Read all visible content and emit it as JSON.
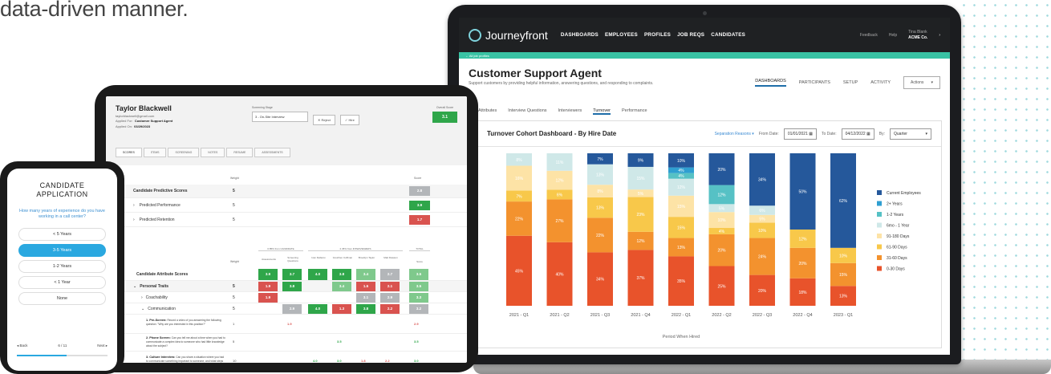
{
  "intro_text": "data-driven manner.",
  "laptop": {
    "app_name": "Journeyfront",
    "nav": [
      "DASHBOARDS",
      "EMPLOYEES",
      "PROFILES",
      "JOB REQS",
      "CANDIDATES"
    ],
    "feedback": "Feedback",
    "help": "Help",
    "user_name": "Tina Blank",
    "company": "ACME Co.",
    "back_link": "← All job profiles",
    "title": "Customer Support Agent",
    "subtitle": "Support customers by providing helpful information, answering questions, and responding to complaints.",
    "tabs": [
      "DASHBOARDS",
      "PARTICIPANTS",
      "SETUP",
      "ACTIVITY"
    ],
    "actions": "Actions",
    "subtabs": [
      "Attributes",
      "Interview Questions",
      "Interviewers",
      "Turnover",
      "Performance"
    ],
    "active_subtab": "Turnover",
    "card_title": "Turnover Cohort Dashboard - By Hire Date",
    "separation": "Separation Reasons",
    "from_label": "From Date:",
    "from_date": "01/01/2021",
    "to_label": "To Date:",
    "to_date": "04/12/2022",
    "by_label": "By:",
    "by_value": "Quarter"
  },
  "chart_data": {
    "type": "bar",
    "stacked": true,
    "xlabel": "Period When Hired",
    "categories": [
      "2021 - Q1",
      "2021 - Q2",
      "2021 - Q3",
      "2021 - Q4",
      "2022 - Q1",
      "2022 - Q2",
      "2022 - Q3",
      "2022 - Q4",
      "2023 - Q1"
    ],
    "series": [
      {
        "name": "0-30 Days",
        "color": "#e8532b",
        "values": [
          45,
          40,
          34,
          37,
          35,
          25,
          20,
          18,
          13
        ]
      },
      {
        "name": "31-60 Days",
        "color": "#f3922e",
        "values": [
          22,
          27,
          22,
          12,
          13,
          20,
          24,
          20,
          15
        ]
      },
      {
        "name": "61-90 Days",
        "color": "#f8c84a",
        "values": [
          7,
          6,
          13,
          23,
          15,
          4,
          10,
          12,
          10
        ]
      },
      {
        "name": "91-180 Days",
        "color": "#fde3a6",
        "values": [
          16,
          12,
          8,
          5,
          15,
          10,
          5,
          0,
          0
        ]
      },
      {
        "name": "6mo - 1 Year",
        "color": "#cfe8e8",
        "values": [
          8,
          11,
          13,
          15,
          12,
          5,
          6,
          0,
          0
        ]
      },
      {
        "name": "1-2 Years",
        "color": "#56c1c5",
        "values": [
          0,
          0,
          0,
          0,
          4,
          12,
          0,
          0,
          0
        ]
      },
      {
        "name": "2+ Years",
        "color": "#2f9fd1",
        "values": [
          0,
          0,
          0,
          0,
          4,
          0,
          0,
          0,
          0
        ]
      },
      {
        "name": "Current Employees",
        "color": "#25589b",
        "values": [
          0,
          0,
          7,
          9,
          10,
          20,
          34,
          50,
          62
        ]
      }
    ],
    "legend_order": [
      "Current Employees",
      "2+ Years",
      "1-2 Years",
      "6mo - 1 Year",
      "91-180 Days",
      "61-90 Days",
      "31-60 Days",
      "0-30 Days"
    ],
    "legend_position": "right",
    "ylim": [
      0,
      100
    ]
  },
  "tablet": {
    "name": "Taylor Blackwell",
    "email": "taylorblackwell@gmail.com",
    "applied_for_label": "Applied For:",
    "applied_for": "Customer Support Agent",
    "applied_on_label": "Applied On:",
    "applied_on": "03/29/2023",
    "stage_label": "Screening Stage",
    "stage_value": "3 - On-Site Interview",
    "reject": "Reject",
    "hire": "Hire",
    "overall_label": "Overall Score",
    "overall_score": "3.1",
    "tabs": [
      "SCORES",
      "ITEMS",
      "SCREENING",
      "NOTES",
      "RESUME",
      "ASSESSMENTS"
    ],
    "weight_header": "Weight",
    "score_header": "Score",
    "predictive_title": "Candidate Predictive Scores",
    "predictive_weight": "5",
    "predictive_score": "2.8",
    "pred_perf": "Predicted Performance",
    "pred_perf_weight": "5",
    "pred_perf_score": "3.9",
    "pred_ret": "Predicted Retention",
    "pred_ret_weight": "5",
    "pred_ret_score": "1.7",
    "group1": "0.85% from CANDIDATE",
    "group2": "2.45% from INTERVIEWERS",
    "total": "TOTAL",
    "col_assess": "Assessments",
    "col_screen": "Screening Questions",
    "col_ivan": "Ivan Dellarov",
    "col_gretchen": "Gretchen Coffman",
    "col_brooklyn": "Brooklyn Taylor",
    "col_matt": "Matt Dawson",
    "attr_title": "Candidate Attribute Scores",
    "attr_scores": [
      "3.9",
      "3.7",
      "4.0",
      "3.8",
      "3.4",
      "2.7",
      "3.5"
    ],
    "pt_label": "Personal Traits",
    "pt_weight": "5",
    "pt_scores": [
      "1.9",
      "3.8",
      "",
      "3.4",
      "1.5",
      "2.1",
      "3.5"
    ],
    "coach_label": "Coachability",
    "coach_weight": "5",
    "coach_scores": [
      "1.9",
      "",
      "",
      "",
      "3.1",
      "2.9",
      "3.3"
    ],
    "comm_label": "Communication",
    "comm_weight": "5",
    "comm_scores": [
      "",
      "2.9",
      "4.0",
      "1.3",
      "3.8",
      "2.2",
      "3.2"
    ],
    "q1_title": "1. Pre-Screen:",
    "q1_text": "Record a video of you answering the following question: \"Why are you interested in this position?\"",
    "q1_weight": "1",
    "q1_scores": [
      "",
      "1.9",
      "",
      "",
      "",
      "",
      "2.9"
    ],
    "q2_title": "2. Phone Screen:",
    "q2_text": "Can you tell me about a time when you had to communicate a complex idea to someone who had little knowledge about the subject?",
    "q2_weight": "5",
    "q2_scores": [
      "",
      "",
      "",
      "3.5",
      "",
      "",
      "3.5"
    ],
    "q3_title": "3. Culture Interview:",
    "q3_text": "Can you share a situation where you had to communicate something important to someone, and what steps did you take to ensure that your message was effectively received and understood by the other person?",
    "q3_weight": "10",
    "q3_scores": [
      "",
      "",
      "4.0",
      "3.0",
      "1.8",
      "2.2",
      "3.0"
    ]
  },
  "phone": {
    "title1": "CANDIDATE",
    "title2": "APPLICATION",
    "question": "How many years of experience do you have working in a call center?",
    "options": [
      "< 5 Years",
      "3-5 Years",
      "1-2 Years",
      "< 1 Year",
      "None"
    ],
    "selected_index": 1,
    "back": "◂  Back",
    "progress_text": "6 / 11",
    "next": "Next  ▸",
    "progress": 0.545
  }
}
